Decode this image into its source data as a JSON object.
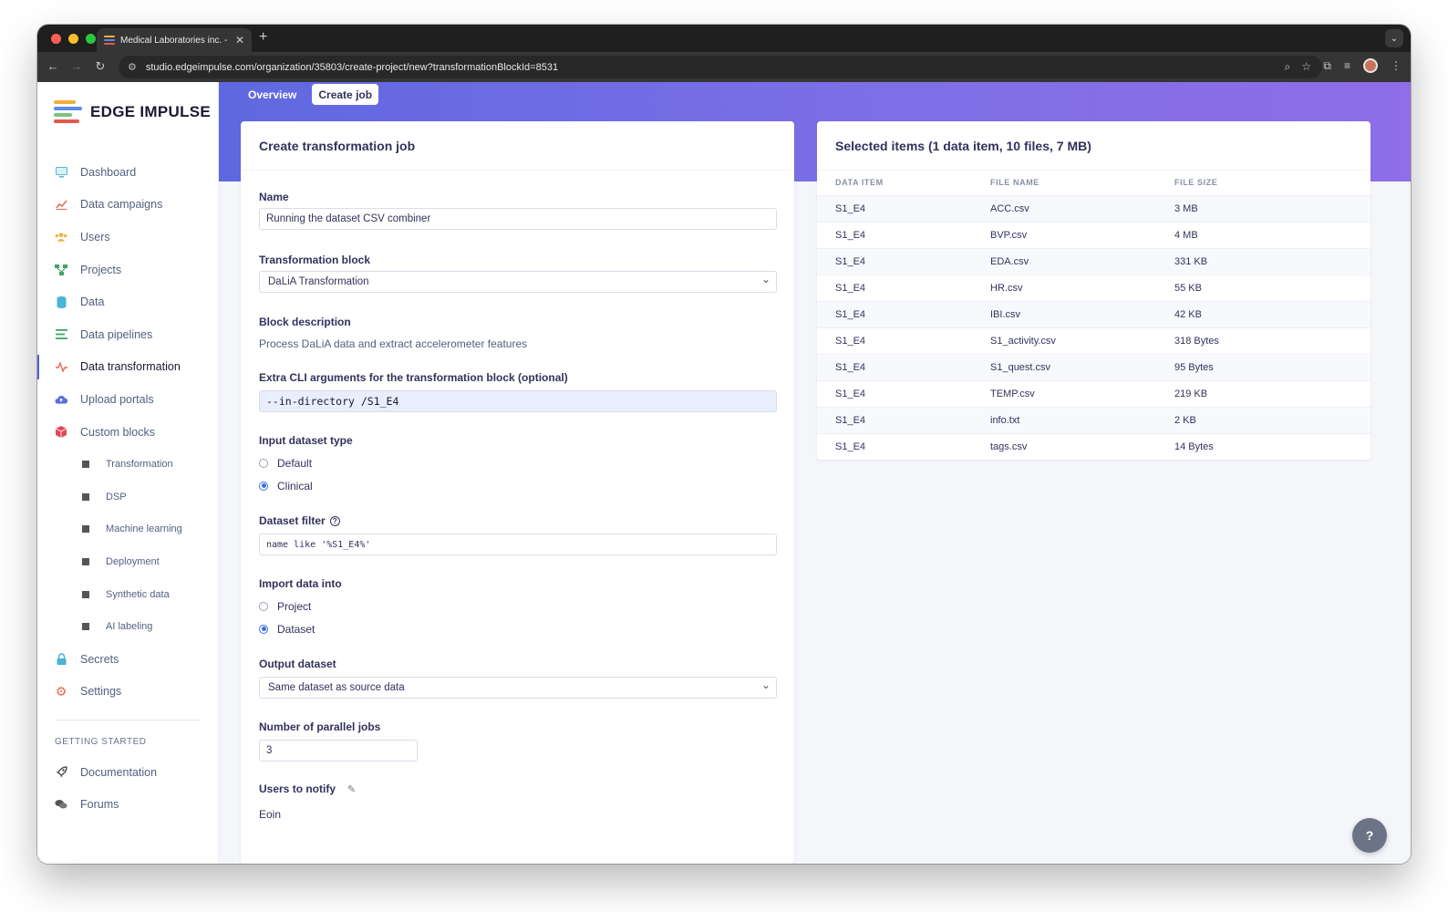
{
  "browser": {
    "tab_title": "Medical Laboratories inc. - C",
    "url": "studio.edgeimpulse.com/organization/35803/create-project/new?transformationBlockId=8531"
  },
  "brand": {
    "name": "EDGE IMPULSE"
  },
  "sidebar": {
    "items": [
      {
        "label": "Dashboard",
        "icon": "monitor-icon"
      },
      {
        "label": "Data campaigns",
        "icon": "chart-icon"
      },
      {
        "label": "Users",
        "icon": "users-icon"
      },
      {
        "label": "Projects",
        "icon": "projects-icon"
      },
      {
        "label": "Data",
        "icon": "database-icon"
      },
      {
        "label": "Data pipelines",
        "icon": "pipelines-icon"
      },
      {
        "label": "Data transformation",
        "icon": "pulse-icon"
      },
      {
        "label": "Upload portals",
        "icon": "cloud-upload-icon"
      },
      {
        "label": "Custom blocks",
        "icon": "cube-icon"
      }
    ],
    "sub_items": [
      {
        "label": "Transformation"
      },
      {
        "label": "DSP"
      },
      {
        "label": "Machine learning"
      },
      {
        "label": "Deployment"
      },
      {
        "label": "Synthetic data"
      },
      {
        "label": "AI labeling"
      }
    ],
    "after_items": [
      {
        "label": "Secrets",
        "icon": "lock-icon"
      },
      {
        "label": "Settings",
        "icon": "gear-icon"
      }
    ],
    "section_label": "GETTING STARTED",
    "bottom_items": [
      {
        "label": "Documentation",
        "icon": "rocket-icon"
      },
      {
        "label": "Forums",
        "icon": "chat-icon"
      }
    ]
  },
  "tabs": [
    {
      "label": "Overview"
    },
    {
      "label": "Create job"
    }
  ],
  "form": {
    "title": "Create transformation job",
    "name_label": "Name",
    "name_value": "Running the dataset CSV combiner",
    "block_label": "Transformation block",
    "block_value": "DaLiA Transformation",
    "desc_label": "Block description",
    "desc_value": "Process DaLiA data and extract accelerometer features",
    "cli_label": "Extra CLI arguments for the transformation block (optional)",
    "cli_value": "--in-directory /S1_E4",
    "input_type_label": "Input dataset type",
    "input_type_options": [
      "Default",
      "Clinical"
    ],
    "filter_label": "Dataset filter",
    "filter_value": "name like '%S1_E4%'",
    "import_label": "Import data into",
    "import_options": [
      "Project",
      "Dataset"
    ],
    "output_label": "Output dataset",
    "output_value": "Same dataset as source data",
    "parallel_label": "Number of parallel jobs",
    "parallel_value": "3",
    "notify_label": "Users to notify",
    "notify_value": "Eoin"
  },
  "selected": {
    "title": "Selected items (1 data item, 10 files, 7 MB)",
    "columns": [
      "DATA ITEM",
      "FILE NAME",
      "FILE SIZE"
    ],
    "rows": [
      [
        "S1_E4",
        "ACC.csv",
        "3 MB"
      ],
      [
        "S1_E4",
        "BVP.csv",
        "4 MB"
      ],
      [
        "S1_E4",
        "EDA.csv",
        "331 KB"
      ],
      [
        "S1_E4",
        "HR.csv",
        "55 KB"
      ],
      [
        "S1_E4",
        "IBI.csv",
        "42 KB"
      ],
      [
        "S1_E4",
        "S1_activity.csv",
        "318 Bytes"
      ],
      [
        "S1_E4",
        "S1_quest.csv",
        "95 Bytes"
      ],
      [
        "S1_E4",
        "TEMP.csv",
        "219 KB"
      ],
      [
        "S1_E4",
        "info.txt",
        "2 KB"
      ],
      [
        "S1_E4",
        "tags.csv",
        "14 Bytes"
      ]
    ]
  },
  "colors": {
    "accent": "#5f68e0",
    "radio": "#3b6ee8"
  }
}
